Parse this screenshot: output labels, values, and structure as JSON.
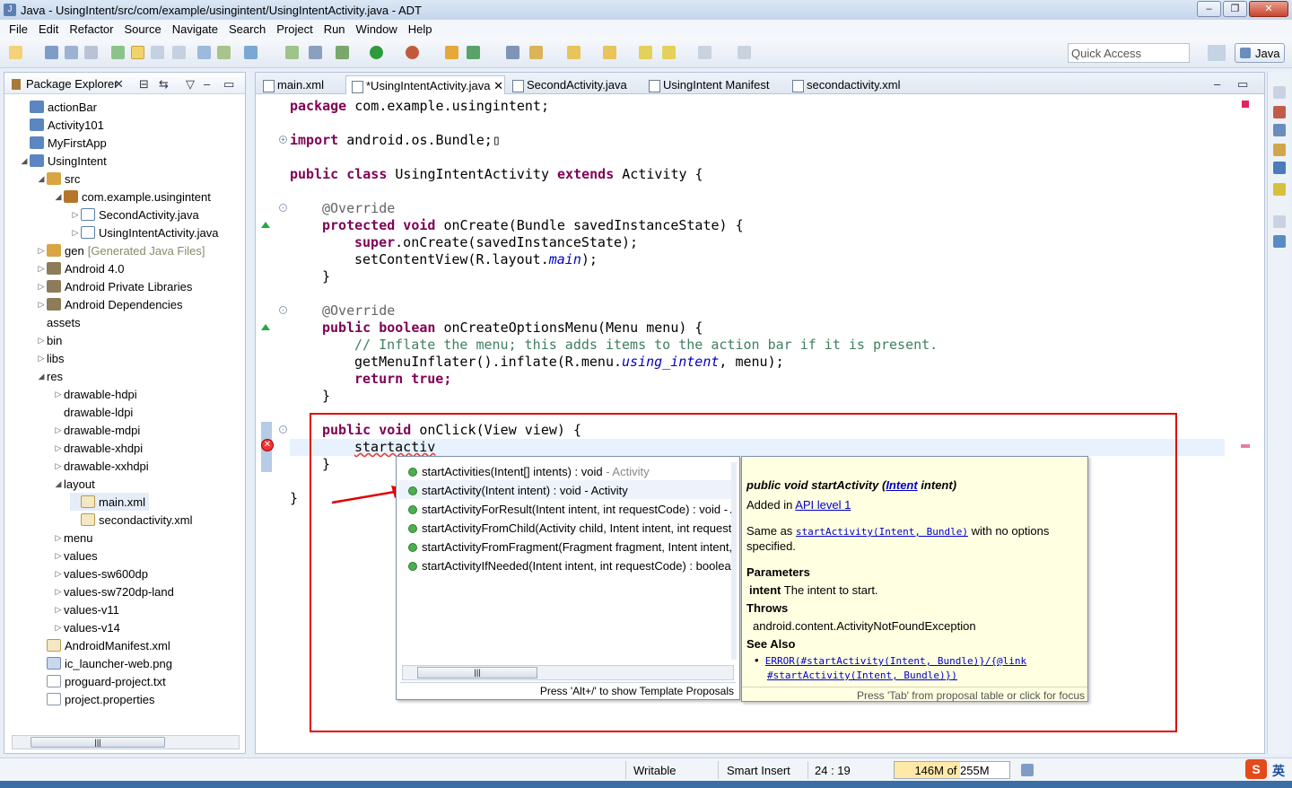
{
  "window": {
    "title": "Java - UsingIntent/src/com/example/usingintent/UsingIntentActivity.java - ADT",
    "controls": [
      "–",
      "❐",
      "✕"
    ]
  },
  "menu": [
    "File",
    "Edit",
    "Refactor",
    "Source",
    "Navigate",
    "Search",
    "Project",
    "Run",
    "Window",
    "Help"
  ],
  "toolbar": {
    "quick_access": "Quick Access",
    "perspective": "Java"
  },
  "package_explorer": {
    "title": "Package Explorer",
    "items": [
      {
        "label": "actionBar",
        "extra": ""
      },
      {
        "label": "Activity101",
        "extra": ""
      },
      {
        "label": "MyFirstApp",
        "extra": ""
      },
      {
        "label": "UsingIntent",
        "extra": ""
      },
      {
        "label": "src",
        "extra": ""
      },
      {
        "label": "com.example.usingintent",
        "extra": ""
      },
      {
        "label": "SecondActivity.java",
        "extra": ""
      },
      {
        "label": "UsingIntentActivity.java",
        "extra": ""
      },
      {
        "label": "gen",
        "extra": "[Generated Java Files]"
      },
      {
        "label": "Android 4.0",
        "extra": ""
      },
      {
        "label": "Android Private Libraries",
        "extra": ""
      },
      {
        "label": "Android Dependencies",
        "extra": ""
      },
      {
        "label": "assets",
        "extra": ""
      },
      {
        "label": "bin",
        "extra": ""
      },
      {
        "label": "libs",
        "extra": ""
      },
      {
        "label": "res",
        "extra": ""
      },
      {
        "label": "drawable-hdpi",
        "extra": ""
      },
      {
        "label": "drawable-ldpi",
        "extra": ""
      },
      {
        "label": "drawable-mdpi",
        "extra": ""
      },
      {
        "label": "drawable-xhdpi",
        "extra": ""
      },
      {
        "label": "drawable-xxhdpi",
        "extra": ""
      },
      {
        "label": "layout",
        "extra": ""
      },
      {
        "label": "main.xml",
        "extra": ""
      },
      {
        "label": "secondactivity.xml",
        "extra": ""
      },
      {
        "label": "menu",
        "extra": ""
      },
      {
        "label": "values",
        "extra": ""
      },
      {
        "label": "values-sw600dp",
        "extra": ""
      },
      {
        "label": "values-sw720dp-land",
        "extra": ""
      },
      {
        "label": "values-v11",
        "extra": ""
      },
      {
        "label": "values-v14",
        "extra": ""
      },
      {
        "label": "AndroidManifest.xml",
        "extra": ""
      },
      {
        "label": "ic_launcher-web.png",
        "extra": ""
      },
      {
        "label": "proguard-project.txt",
        "extra": ""
      },
      {
        "label": "project.properties",
        "extra": ""
      }
    ]
  },
  "editor_tabs": [
    "main.xml",
    "*UsingIntentActivity.java",
    "SecondActivity.java",
    "UsingIntent Manifest",
    "secondactivity.xml"
  ],
  "code": {
    "l1": "com.example.usingintent;",
    "l2": "android.os.Bundle;",
    "l3a": "UsingIntentActivity",
    "l3b": "Activity {",
    "override": "@Override",
    "oncreate": "onCreate(Bundle savedInstanceState) {",
    "super": ".onCreate(savedInstanceState);",
    "setcv_a": "setContentView(R.layout.",
    "setcv_b": "main",
    "setcv_c": ");",
    "brace": "}",
    "menu_sig": "onCreateOptionsMenu(Menu menu) {",
    "comment": "// Inflate the menu; this adds items to the action bar if it is present.",
    "inflate_a": "getMenuInflater().inflate(R.menu.",
    "inflate_b": "using_intent",
    "inflate_c": ", menu);",
    "ret": "true;",
    "onclick": "onClick(View view) {",
    "typed": "startactiv"
  },
  "proposals": [
    {
      "label": "startActivities(Intent[] intents) : void",
      "owner": " - Activity"
    },
    {
      "label": "startActivity(Intent intent) : void - Activity",
      "owner": ""
    },
    {
      "label": "startActivityForResult(Intent intent, int requestCode) : void - A",
      "owner": ""
    },
    {
      "label": "startActivityFromChild(Activity child, Intent intent, int requestC",
      "owner": ""
    },
    {
      "label": "startActivityFromFragment(Fragment fragment, Intent intent, i",
      "owner": ""
    },
    {
      "label": "startActivityIfNeeded(Intent intent, int requestCode) : boolea",
      "owner": ""
    }
  ],
  "proposals_footer": "Press 'Alt+/' to show Template Proposals",
  "doc": {
    "sig_a": "public void startActivity (",
    "sig_link": "Intent",
    "sig_b": " intent)",
    "added": "Added in ",
    "api": "API level 1",
    "same_as": "Same as ",
    "same_link": "startActivity(Intent, Bundle)",
    "same_rest": " with no options",
    "specified": "specified.",
    "params": "Parameters",
    "param_name": "intent",
    "param_desc": " The intent to start.",
    "throws": "Throws",
    "exc": "android.content.ActivityNotFoundException",
    "see": "See Also",
    "see1": "ERROR(#startActivity(Intent, Bundle)}/{@link",
    "see2": "#startActivity(Intent, Bundle)})",
    "footer": "Press 'Tab' from proposal table or click for focus"
  },
  "status": {
    "writable": "Writable",
    "insert": "Smart Insert",
    "pos": "24 : 19",
    "heap": "146M of 255M",
    "heap_fraction": 0.57,
    "ime": "英"
  }
}
